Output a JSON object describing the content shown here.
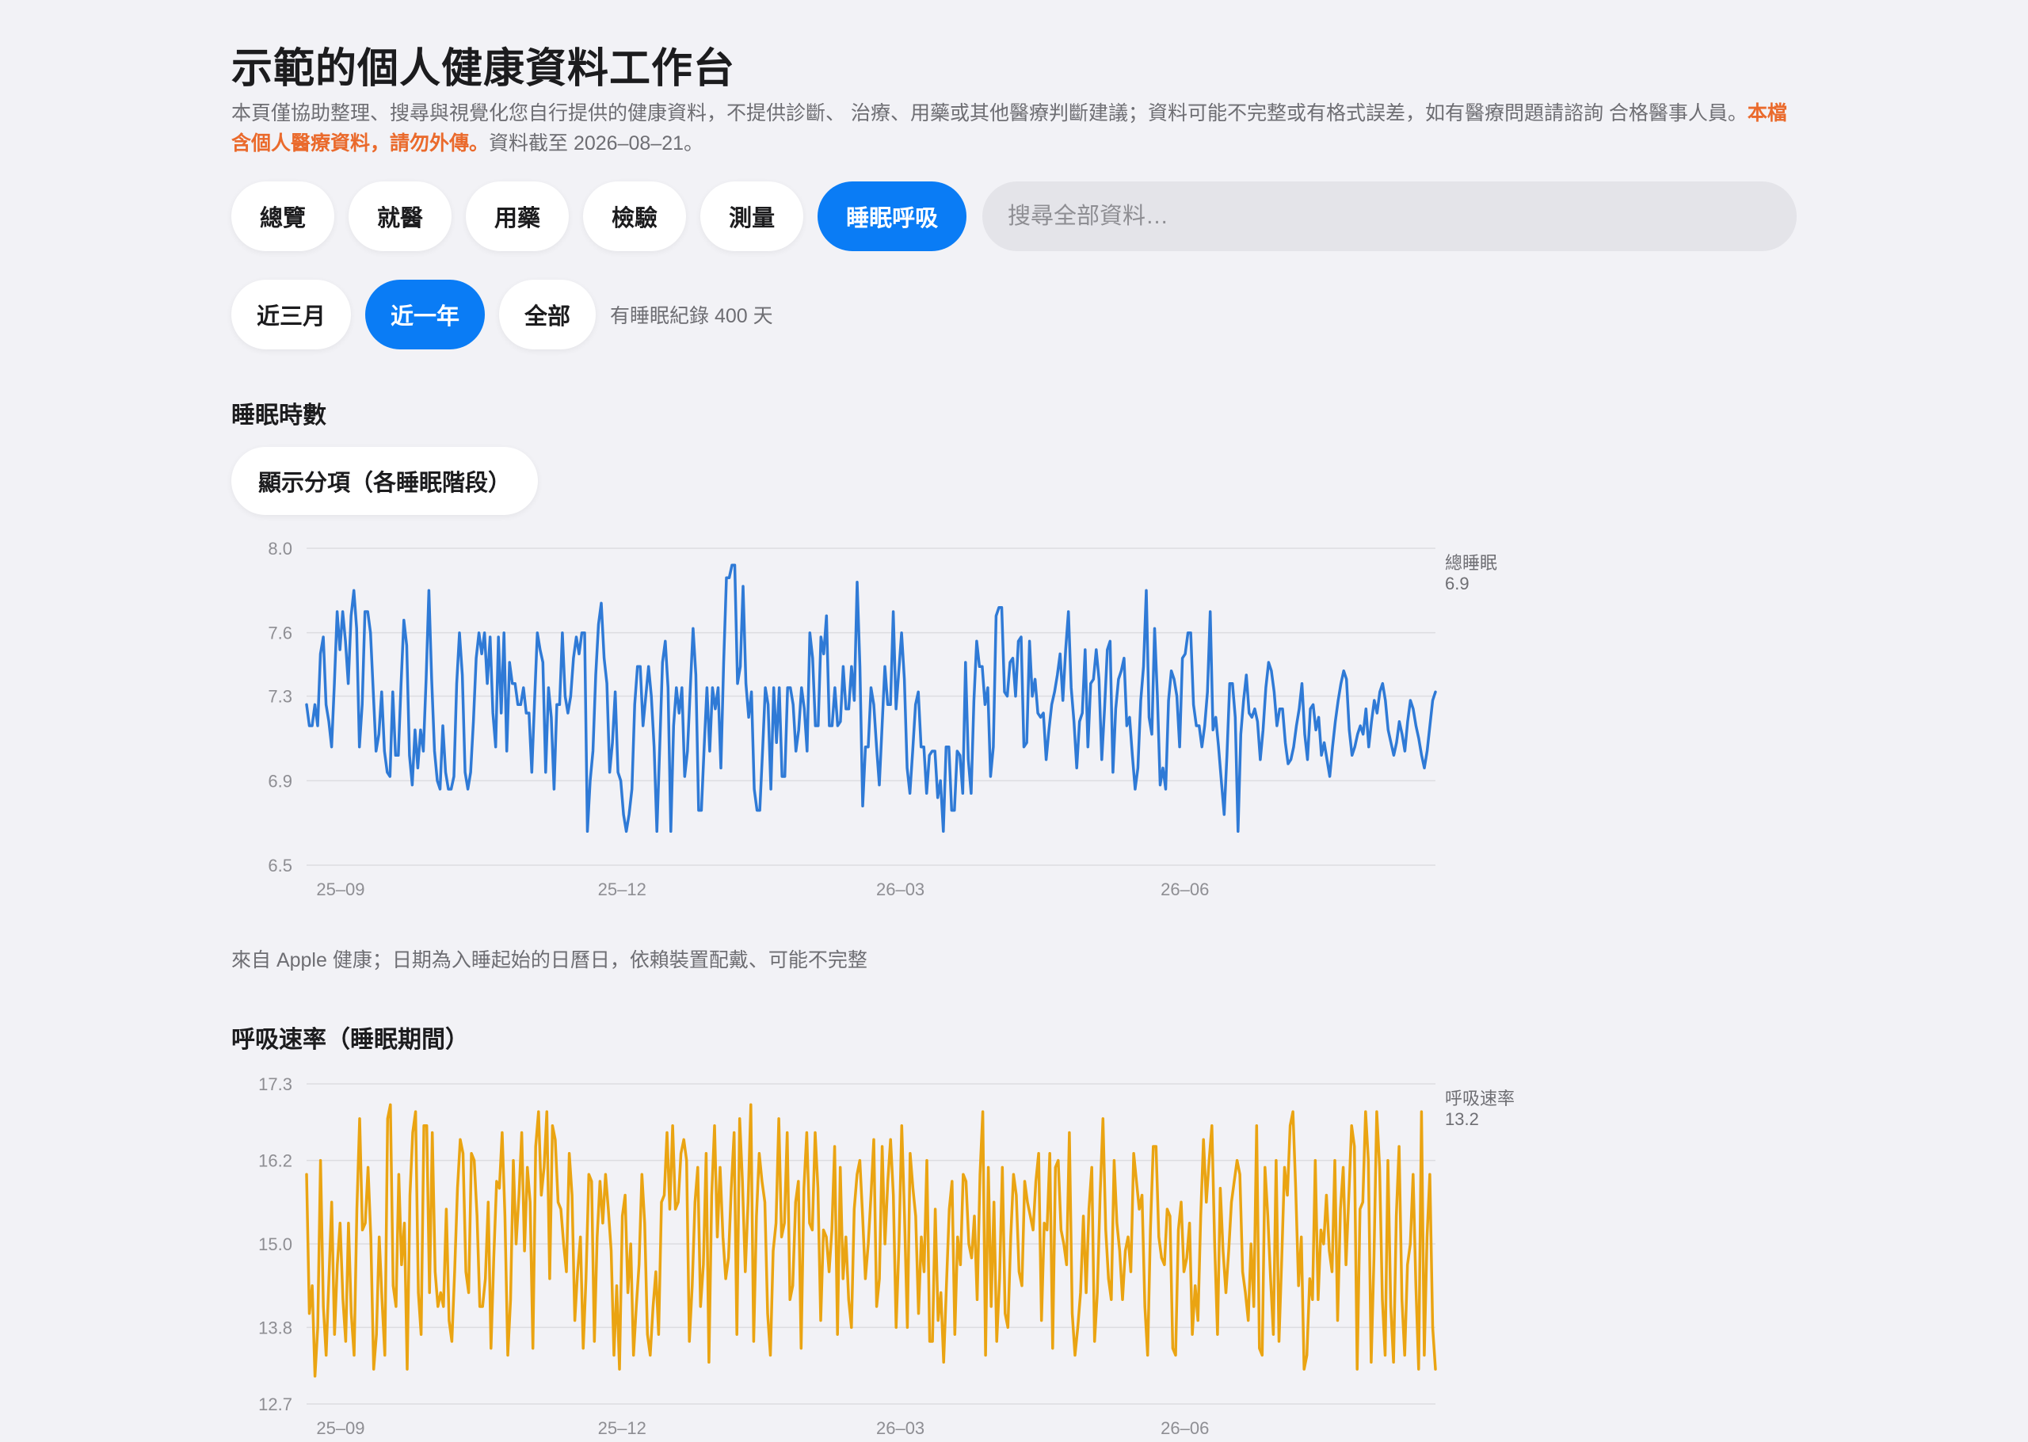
{
  "header": {
    "title": "示範的個人健康資料工作台",
    "desc_text": "本頁僅協助整理、搜尋與視覺化您自行提供的健康資料，不提供診斷、 治療、用藥或其他醫療判斷建議；資料可能不完整或有格式誤差，如有醫療問題請諮詢 合格醫事人員。",
    "desc_warning": "本檔含個人醫療資料，請勿外傳。",
    "desc_date": "資料截至 2026–08–21。"
  },
  "tabs": [
    {
      "label": "總覽",
      "active": false
    },
    {
      "label": "就醫",
      "active": false
    },
    {
      "label": "用藥",
      "active": false
    },
    {
      "label": "檢驗",
      "active": false
    },
    {
      "label": "測量",
      "active": false
    },
    {
      "label": "睡眠呼吸",
      "active": true
    }
  ],
  "search": {
    "placeholder": "搜尋全部資料…",
    "value": ""
  },
  "ranges": {
    "options": [
      {
        "label": "近三月",
        "active": false
      },
      {
        "label": "近一年",
        "active": true
      },
      {
        "label": "全部",
        "active": false
      }
    ],
    "note": "有睡眠紀錄 400 天"
  },
  "sleep_section": {
    "title": "睡眠時數",
    "toggle_label": "顯示分項（各睡眠階段）",
    "note": "來自 Apple 健康；日期為入睡起始的日曆日，依賴裝置配戴、可能不完整"
  },
  "resp_section": {
    "title": "呼吸速率（睡眠期間）"
  },
  "colors": {
    "accent": "#0a7cf5",
    "warning": "#ea6a2c",
    "sleep_line": "#2f7ad6",
    "resp_line": "#eaa412"
  },
  "chart_data": [
    {
      "type": "line",
      "title": "睡眠時數",
      "ylim": [
        6.5,
        8.0
      ],
      "y_ticks": [
        "8.0",
        "7.6",
        "7.3",
        "6.9",
        "6.5"
      ],
      "x_ticks": [
        "25–09",
        "25–12",
        "26–03",
        "26–06"
      ],
      "x_range": [
        "2025-08-21",
        "2026-08-21"
      ],
      "x_tick_dates": [
        "2025-09-01",
        "2025-12-01",
        "2026-03-01",
        "2026-06-01"
      ],
      "series": [
        {
          "name": "總睡眠",
          "latest_label": "6.9",
          "values": [
            7.26,
            7.16,
            7.16,
            7.26,
            7.16,
            7.5,
            7.58,
            7.26,
            7.18,
            7.06,
            7.36,
            7.7,
            7.52,
            7.7,
            7.56,
            7.36,
            7.68,
            7.8,
            7.62,
            7.06,
            7.26,
            7.7,
            7.7,
            7.6,
            7.32,
            7.04,
            7.12,
            7.32,
            7.04,
            6.94,
            6.92,
            7.32,
            7.02,
            7.02,
            7.36,
            7.66,
            7.54,
            7.02,
            6.88,
            7.14,
            6.96,
            7.14,
            7.04,
            7.38,
            7.8,
            7.38,
            7.04,
            6.9,
            6.86,
            7.16,
            6.94,
            6.86,
            6.86,
            6.92,
            7.36,
            7.6,
            7.4,
            6.94,
            6.86,
            6.94,
            7.18,
            7.48,
            7.6,
            7.5,
            7.6,
            7.36,
            7.58,
            7.22,
            7.06,
            7.58,
            7.22,
            7.6,
            7.04,
            7.46,
            7.36,
            7.36,
            7.26,
            7.26,
            7.34,
            7.22,
            7.22,
            6.94,
            7.28,
            7.6,
            7.52,
            7.46,
            6.94,
            7.34,
            7.2,
            6.86,
            7.26,
            7.26,
            7.6,
            7.3,
            7.22,
            7.3,
            7.48,
            7.58,
            7.5,
            7.6,
            7.6,
            6.66,
            6.9,
            7.04,
            7.4,
            7.64,
            7.74,
            7.48,
            7.36,
            6.94,
            7.08,
            7.32,
            6.94,
            6.9,
            6.74,
            6.66,
            6.74,
            6.86,
            7.26,
            7.44,
            7.44,
            7.16,
            7.3,
            7.44,
            7.3,
            7.06,
            6.66,
            7.06,
            7.46,
            7.56,
            7.34,
            6.66,
            7.16,
            7.34,
            7.22,
            7.34,
            6.92,
            7.04,
            7.34,
            7.62,
            7.4,
            6.76,
            6.76,
            7.06,
            7.34,
            7.04,
            7.34,
            7.24,
            7.34,
            6.96,
            7.46,
            7.86,
            7.86,
            7.92,
            7.92,
            7.36,
            7.44,
            7.82,
            7.36,
            7.2,
            7.32,
            6.86,
            6.76,
            6.76,
            7.04,
            7.34,
            7.26,
            6.86,
            7.34,
            7.08,
            7.34,
            6.92,
            6.92,
            7.34,
            7.34,
            7.26,
            7.04,
            7.14,
            7.34,
            7.24,
            7.04,
            7.6,
            7.48,
            7.16,
            7.16,
            7.58,
            7.5,
            7.68,
            7.16,
            7.16,
            7.34,
            7.16,
            7.18,
            7.44,
            7.24,
            7.24,
            7.44,
            7.28,
            7.84,
            7.44,
            6.78,
            7.06,
            7.06,
            7.34,
            7.26,
            7.06,
            6.88,
            7.16,
            7.44,
            7.26,
            7.26,
            7.7,
            7.24,
            7.42,
            7.6,
            7.38,
            6.96,
            6.84,
            7.04,
            7.26,
            7.32,
            7.06,
            7.06,
            6.84,
            7.02,
            7.04,
            7.04,
            6.82,
            6.9,
            6.66,
            7.06,
            7.06,
            6.76,
            6.76,
            7.04,
            7.02,
            6.84,
            7.46,
            7.0,
            6.84,
            7.28,
            7.56,
            7.44,
            7.44,
            7.26,
            7.34,
            6.92,
            7.06,
            7.68,
            7.72,
            7.72,
            7.32,
            7.3,
            7.46,
            7.48,
            7.3,
            7.56,
            7.58,
            7.06,
            7.08,
            7.56,
            7.3,
            7.38,
            7.22,
            7.2,
            7.22,
            7.0,
            7.14,
            7.26,
            7.32,
            7.4,
            7.5,
            7.28,
            7.52,
            7.7,
            7.34,
            7.18,
            6.96,
            7.18,
            7.22,
            7.52,
            7.06,
            7.36,
            7.38,
            7.52,
            7.38,
            7.0,
            7.24,
            7.52,
            7.56,
            6.94,
            7.24,
            7.38,
            7.42,
            7.48,
            7.16,
            7.2,
            7.02,
            6.86,
            6.96,
            7.28,
            7.44,
            7.8,
            7.2,
            7.12,
            7.62,
            7.3,
            6.88,
            6.96,
            6.86,
            7.28,
            7.42,
            7.38,
            7.3,
            7.06,
            7.48,
            7.5,
            7.6,
            7.6,
            7.26,
            7.16,
            7.16,
            7.06,
            7.16,
            7.32,
            7.7,
            7.14,
            7.2,
            7.06,
            6.9,
            6.74,
            7.02,
            7.36,
            7.36,
            7.2,
            6.66,
            7.12,
            7.28,
            7.4,
            7.22,
            7.2,
            7.24,
            7.18,
            7.0,
            7.14,
            7.34,
            7.46,
            7.42,
            7.32,
            7.16,
            7.24,
            7.24,
            7.08,
            6.98,
            7.0,
            7.06,
            7.16,
            7.24,
            7.36,
            7.12,
            7.0,
            7.24,
            7.26,
            7.14,
            7.2,
            7.02,
            7.08,
            7.0,
            6.92,
            7.06,
            7.18,
            7.28,
            7.36,
            7.42,
            7.38,
            7.14,
            7.02,
            7.06,
            7.12,
            7.16,
            7.12,
            7.24,
            7.06,
            7.18,
            7.28,
            7.22,
            7.32,
            7.36,
            7.28,
            7.14,
            7.08,
            7.02,
            7.08,
            7.18,
            7.12,
            7.04,
            7.18,
            7.28,
            7.24,
            7.16,
            7.1,
            7.02,
            6.96,
            7.04,
            7.16,
            7.28,
            7.32
          ]
        }
      ]
    },
    {
      "type": "line",
      "title": "呼吸速率（睡眠期間）",
      "ylim": [
        12.7,
        17.3
      ],
      "y_ticks": [
        "17.3",
        "16.2",
        "15.0",
        "13.8",
        "12.7"
      ],
      "x_ticks": [
        "25–09",
        "25–12",
        "26–03",
        "26–06"
      ],
      "x_range": [
        "2025-08-21",
        "2026-08-21"
      ],
      "x_tick_dates": [
        "2025-09-01",
        "2025-12-01",
        "2026-03-01",
        "2026-06-01"
      ],
      "series": [
        {
          "name": "呼吸速率",
          "latest_label": "13.2",
          "values": [
            16.0,
            14.0,
            14.4,
            13.1,
            13.8,
            16.2,
            14.1,
            13.4,
            14.5,
            15.6,
            13.7,
            14.7,
            15.3,
            14.2,
            13.6,
            15.3,
            14.0,
            13.4,
            15.5,
            16.8,
            15.2,
            15.3,
            16.1,
            15.1,
            13.2,
            13.7,
            15.1,
            14.2,
            13.4,
            16.8,
            17.0,
            14.4,
            14.1,
            16.0,
            14.7,
            15.3,
            13.2,
            15.7,
            16.6,
            16.9,
            14.3,
            13.7,
            16.7,
            16.7,
            14.3,
            16.6,
            14.6,
            14.1,
            14.3,
            14.1,
            15.5,
            13.9,
            13.6,
            14.6,
            15.8,
            16.5,
            16.3,
            14.6,
            14.3,
            16.3,
            16.2,
            15.4,
            14.1,
            14.1,
            14.5,
            15.6,
            13.5,
            14.8,
            15.9,
            15.8,
            16.6,
            15.4,
            13.4,
            14.2,
            16.2,
            15.0,
            15.7,
            16.6,
            14.9,
            16.1,
            15.6,
            13.5,
            16.4,
            16.9,
            15.7,
            16.1,
            16.9,
            14.5,
            16.7,
            16.5,
            15.6,
            15.5,
            15.0,
            14.6,
            16.3,
            15.7,
            13.9,
            14.6,
            15.1,
            13.5,
            14.5,
            16.0,
            15.9,
            13.6,
            15.1,
            15.9,
            15.3,
            16.0,
            15.5,
            14.9,
            13.4,
            14.4,
            13.2,
            15.4,
            15.7,
            14.3,
            15.0,
            13.4,
            14.1,
            14.7,
            16.0,
            15.3,
            13.7,
            13.4,
            14.1,
            14.6,
            13.7,
            15.6,
            15.7,
            16.6,
            15.5,
            16.7,
            15.5,
            15.6,
            16.3,
            16.5,
            16.2,
            13.6,
            14.4,
            15.6,
            16.1,
            14.1,
            14.7,
            16.3,
            13.3,
            15.7,
            16.7,
            15.1,
            16.1,
            15.1,
            14.5,
            14.8,
            15.8,
            16.6,
            13.7,
            16.8,
            15.9,
            14.6,
            15.6,
            17.0,
            13.6,
            15.4,
            16.3,
            15.9,
            15.6,
            14.0,
            13.4,
            14.9,
            15.3,
            16.8,
            15.1,
            15.3,
            16.6,
            14.2,
            14.4,
            15.6,
            15.9,
            13.5,
            15.8,
            16.6,
            15.3,
            15.2,
            16.6,
            15.8,
            13.9,
            15.2,
            15.1,
            14.6,
            15.2,
            16.4,
            13.7,
            16.1,
            14.5,
            15.1,
            14.2,
            13.8,
            15.5,
            16.0,
            16.2,
            15.4,
            14.5,
            15.0,
            15.7,
            16.5,
            14.1,
            14.5,
            16.4,
            15.0,
            15.9,
            16.5,
            15.7,
            13.8,
            15.0,
            16.7,
            15.4,
            13.8,
            16.3,
            15.8,
            15.4,
            14.0,
            15.1,
            14.6,
            16.2,
            13.6,
            13.6,
            15.5,
            13.9,
            14.3,
            13.3,
            14.4,
            15.5,
            15.9,
            13.7,
            15.1,
            14.7,
            16.0,
            15.9,
            15.0,
            14.8,
            15.4,
            14.2,
            16.0,
            16.9,
            13.4,
            16.1,
            14.1,
            15.6,
            13.6,
            14.5,
            16.1,
            14.0,
            13.8,
            15.1,
            16.0,
            15.7,
            14.6,
            14.4,
            15.9,
            15.6,
            15.4,
            15.2,
            15.9,
            16.3,
            13.9,
            15.3,
            15.2,
            16.3,
            13.5,
            16.1,
            16.2,
            15.2,
            15.0,
            14.7,
            16.6,
            14.0,
            13.4,
            13.8,
            14.3,
            15.4,
            14.3,
            15.5,
            16.1,
            13.6,
            14.3,
            15.7,
            16.8,
            15.2,
            14.5,
            14.2,
            16.2,
            15.3,
            14.9,
            14.2,
            14.9,
            15.1,
            14.6,
            16.3,
            15.9,
            15.5,
            15.7,
            14.1,
            13.4,
            15.2,
            16.4,
            16.4,
            15.1,
            14.8,
            14.7,
            15.5,
            15.4,
            13.5,
            13.4,
            15.2,
            15.6,
            14.6,
            14.8,
            15.3,
            13.7,
            14.4,
            13.9,
            15.4,
            16.5,
            15.6,
            16.2,
            16.7,
            15.0,
            13.7,
            15.8,
            14.9,
            14.3,
            14.9,
            15.6,
            15.9,
            16.2,
            16.0,
            14.6,
            14.3,
            13.9,
            15.0,
            14.1,
            16.7,
            13.5,
            13.4,
            16.1,
            15.4,
            14.5,
            13.7,
            16.2,
            13.6,
            14.8,
            16.1,
            15.7,
            16.7,
            16.9,
            15.8,
            14.4,
            15.1,
            13.2,
            13.4,
            14.5,
            14.2,
            16.2,
            14.2,
            15.2,
            15.0,
            15.7,
            14.9,
            14.6,
            16.2,
            13.9,
            15.5,
            16.1,
            14.7,
            15.7,
            16.7,
            16.4,
            13.2,
            15.5,
            15.6,
            16.9,
            16.2,
            13.3,
            14.8,
            16.9,
            16.1,
            14.2,
            13.4,
            16.2,
            14.1,
            13.3,
            15.4,
            16.4,
            14.2,
            13.4,
            14.7,
            15.0,
            16.0,
            14.4,
            13.2,
            16.9,
            13.4,
            15.1,
            16.0,
            13.8,
            13.2
          ]
        }
      ]
    }
  ]
}
